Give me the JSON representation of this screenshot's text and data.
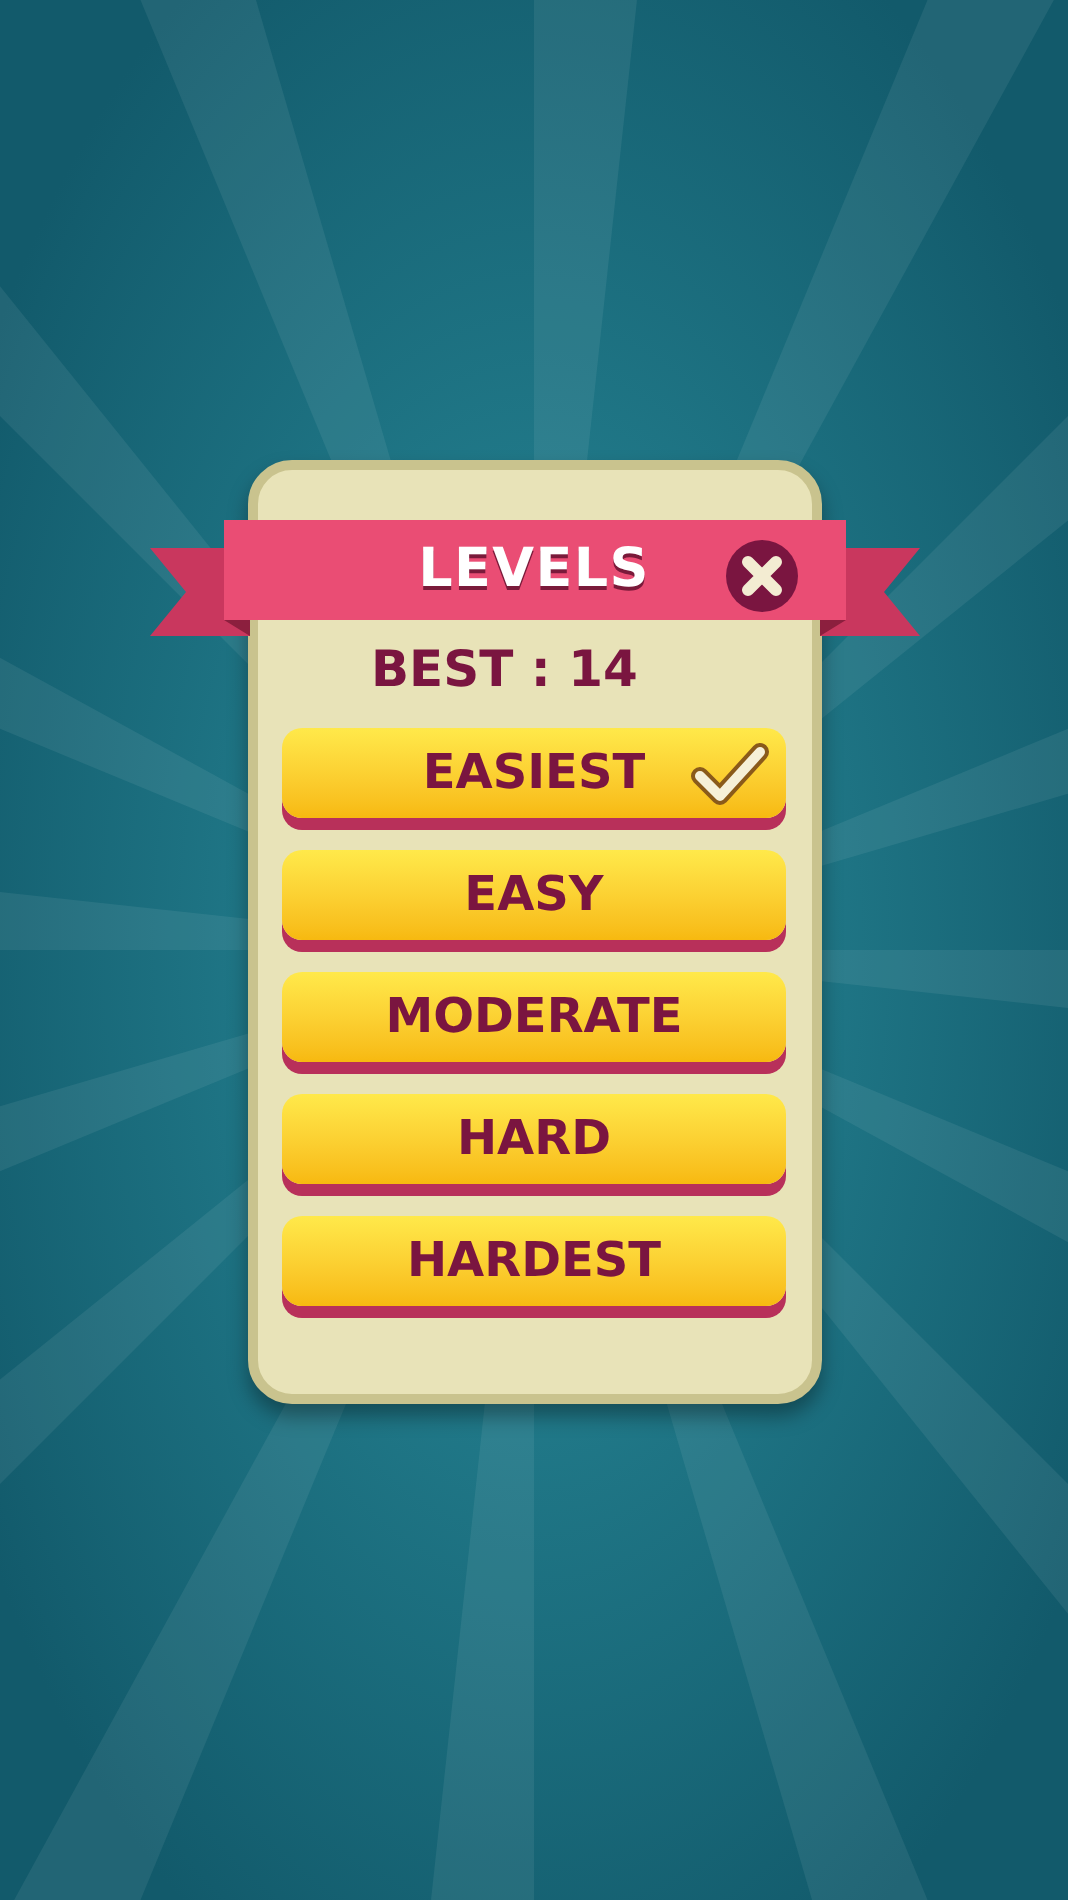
{
  "title": "LEVELS",
  "best": "BEST : 14",
  "levels": [
    {
      "label": "EASIEST",
      "selected": true
    },
    {
      "label": "EASY",
      "selected": false
    },
    {
      "label": "MODERATE",
      "selected": false
    },
    {
      "label": "HARD",
      "selected": false
    },
    {
      "label": "HARDEST",
      "selected": false
    }
  ]
}
